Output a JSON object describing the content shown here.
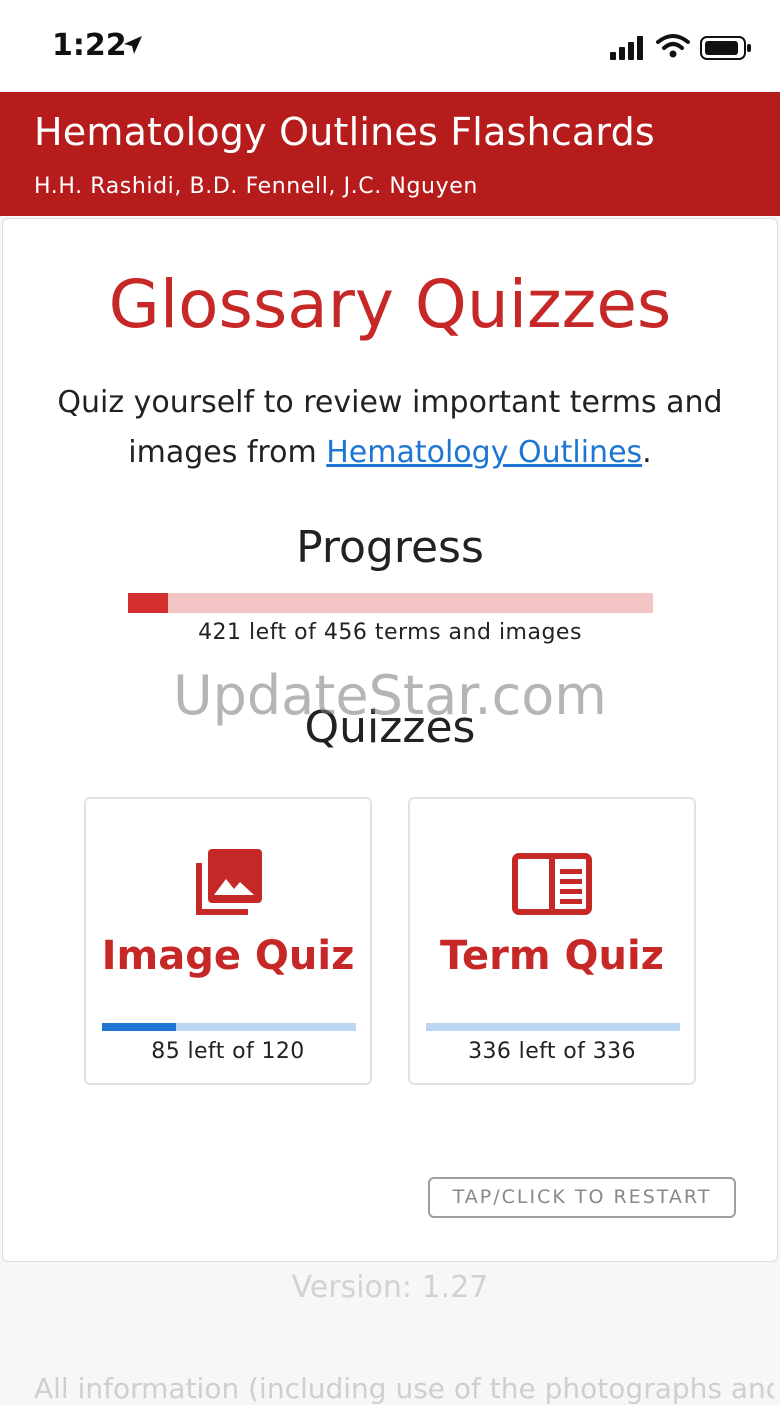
{
  "status_bar": {
    "time": "1:22",
    "icons": [
      "location-arrow-icon",
      "signal-icon",
      "wifi-icon",
      "battery-icon"
    ]
  },
  "header": {
    "title": "Hematology Outlines Flashcards",
    "authors": "H.H. Rashidi, B.D. Fennell, J.C. Nguyen",
    "background_color": "#b71c1c"
  },
  "main": {
    "title": "Glossary Quizzes",
    "intro_prefix": "Quiz yourself to review important terms and images from ",
    "intro_link": "Hematology Outlines",
    "intro_suffix": ".",
    "progress": {
      "heading": "Progress",
      "caption": "421 left of 456 terms and images",
      "fraction_complete": 0.077,
      "fill_color": "#d32f2f",
      "track_color": "#f4c5c5"
    },
    "quizzes_heading": "Quizzes",
    "quizzes": [
      {
        "title": "Image Quiz",
        "icon": "photo-library-icon",
        "caption": "85 left of 120",
        "fraction_complete": 0.29
      },
      {
        "title": "Term Quiz",
        "icon": "book-icon",
        "caption": "336 left of 336",
        "fraction_complete": 0.0
      }
    ],
    "restart_label": "TAP/CLICK TO RESTART"
  },
  "watermark": "UpdateStar.com",
  "footer": {
    "version": "Version: 1.27",
    "disclaimer": "All information (including use of the photographs and"
  },
  "colors": {
    "accent_red": "#c62828",
    "link_blue": "#1e76d2",
    "quiz_track": "#bbd6f2"
  }
}
